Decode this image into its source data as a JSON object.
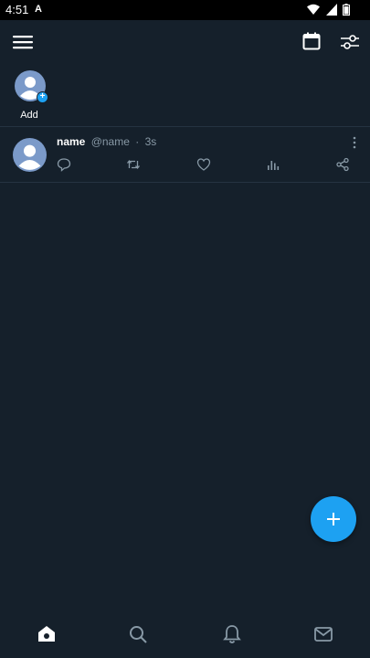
{
  "status_bar": {
    "time": "4:51",
    "app_indicator": "A",
    "icons": [
      "wifi-icon",
      "cellular-signal-icon",
      "battery-icon"
    ]
  },
  "toolbar": {
    "menu_icon": "hamburger-menu-icon",
    "calendar_icon": "calendar-icon",
    "filter_icon": "settings-sliders-icon"
  },
  "fleets": {
    "add_label": "Add"
  },
  "tweet": {
    "name": "name",
    "handle": "@name",
    "separator": "·",
    "time": "3s",
    "actions": [
      "reply-icon",
      "retweet-icon",
      "like-icon",
      "analytics-icon",
      "share-icon"
    ]
  },
  "bottom_nav": {
    "items": [
      "home-icon",
      "search-icon",
      "notifications-icon",
      "messages-icon"
    ]
  },
  "colors": {
    "background": "#15202b",
    "accent": "#1da1f2",
    "secondary_text": "#8899a6",
    "divider": "#253341",
    "avatar": "#7b9ac9"
  }
}
